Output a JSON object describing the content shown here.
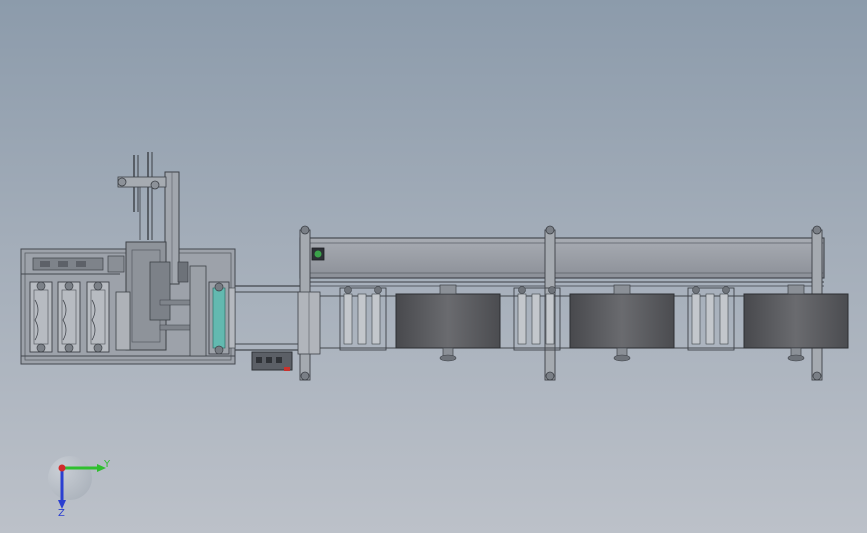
{
  "scene": {
    "type": "cad-assembly-front-view",
    "colors": {
      "background_top": "#8c9bab",
      "background_bottom": "#bcc1c9",
      "frame": "#4a4f57",
      "frame_fill": "#9fa4ac",
      "panel": "#8f949c",
      "roll_dark": "#55575b",
      "green_indicator": "#3ba24a",
      "cyan_roller": "#63b9b0",
      "red_marker": "#c8322d"
    },
    "roll_stations": 3,
    "left_module_rollers": 3
  },
  "triad": {
    "y_label": "Y",
    "z_label": "Z",
    "x_color": "#d12b2b",
    "y_color": "#2fbf2f",
    "z_color": "#2b3fd1"
  }
}
